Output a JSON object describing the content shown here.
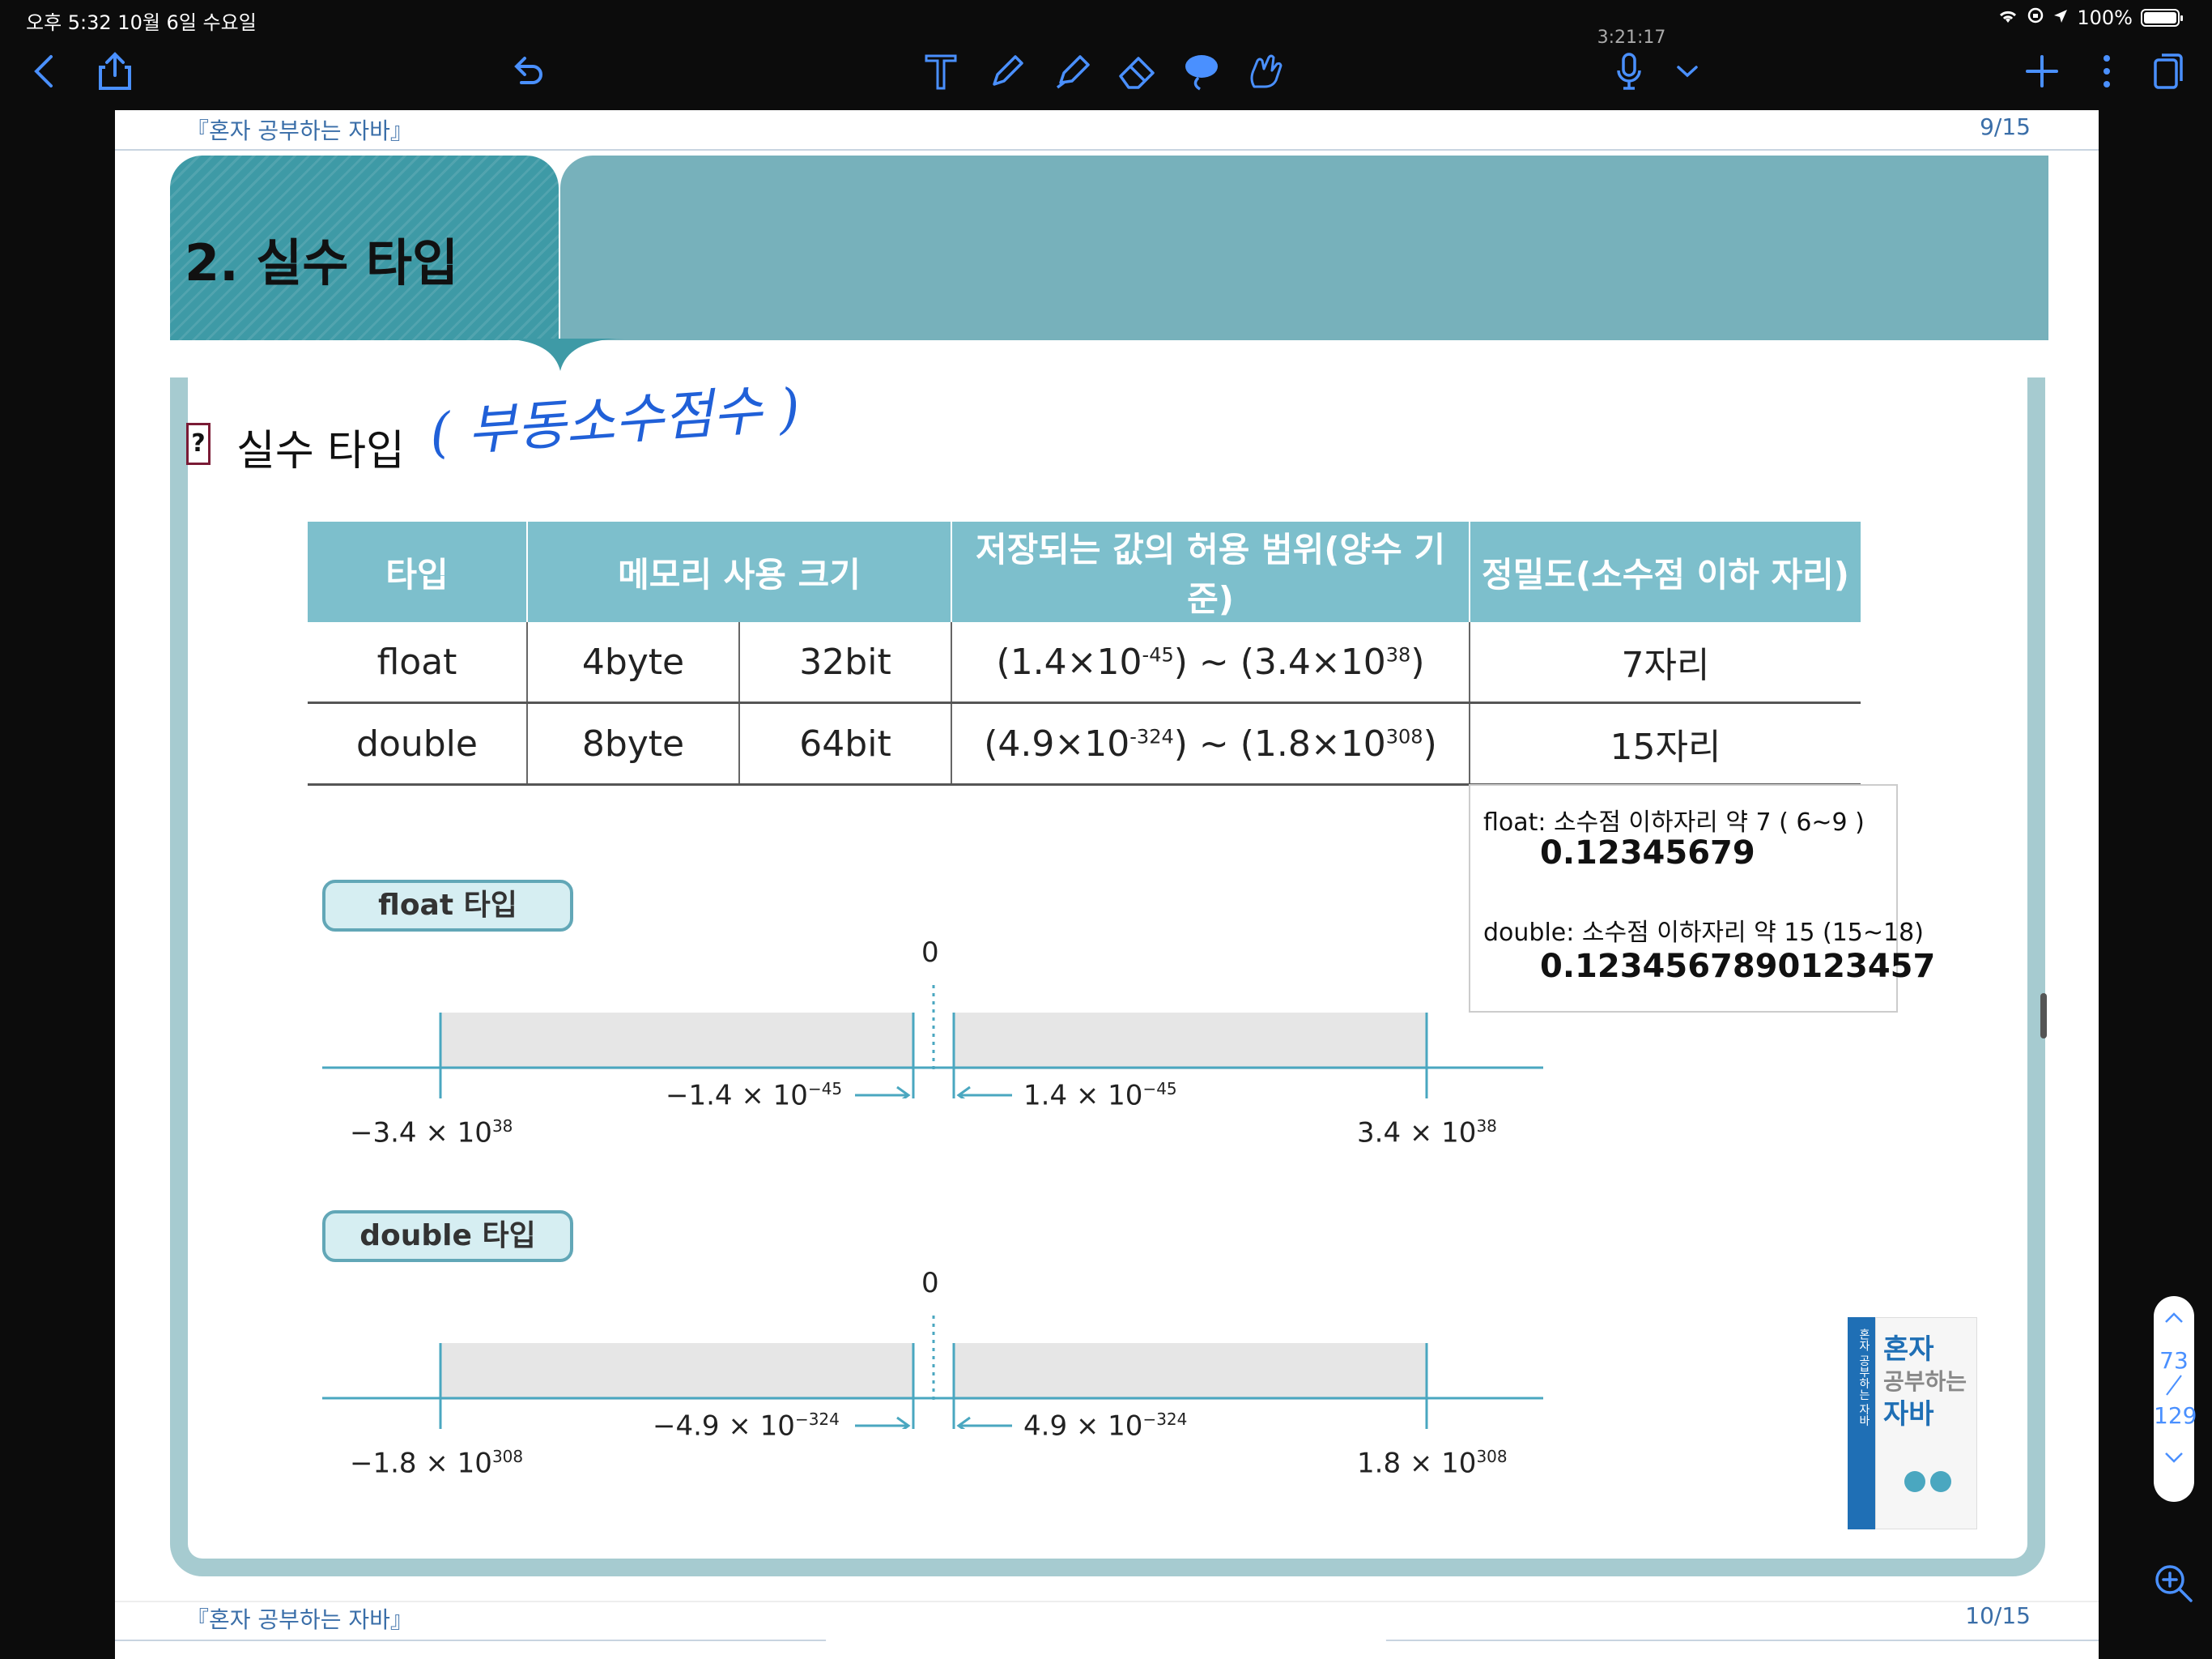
{
  "status_bar": {
    "time_date": "오후 5:32   10월 6일 수요일",
    "battery": "100%"
  },
  "toolbar": {
    "timer": "3:21:17"
  },
  "page": {
    "running_header": "『혼자 공부하는 자바』",
    "page_number": "9/15",
    "next_running_header": "『혼자 공부하는 자바』",
    "next_page_number": "10/15",
    "section_title": "2. 실수 타입",
    "heading": "실수 타입",
    "heading_icon": "?",
    "handwritten_note": "( 부동소수점수 )"
  },
  "table": {
    "headers": [
      "타입",
      "메모리 사용 크기",
      "저장되는 값의 허용 범위(양수 기준)",
      "정밀도(소수점 이하 자리)"
    ],
    "rows": [
      {
        "type": "float",
        "bytes": "4byte",
        "bits": "32bit",
        "range_a": "1.4",
        "exp_a": "-45",
        "range_b": "3.4",
        "exp_b": "38",
        "precision": "7자리"
      },
      {
        "type": "double",
        "bytes": "8byte",
        "bits": "64bit",
        "range_a": "4.9",
        "exp_a": "-324",
        "range_b": "1.8",
        "exp_b": "308",
        "precision": "15자리"
      }
    ],
    "times": "×10",
    "tilde": "~"
  },
  "note_box": {
    "float_label": "float: 소수점 이하자리 약 7 ( 6~9 )",
    "float_value": "0.12345679",
    "double_label": "double: 소수점 이하자리 약 15  (15~18)",
    "double_value": "0.1234567890123457"
  },
  "float_diagram": {
    "label": "float 타입",
    "zero": "0",
    "neg_max": "−3.4 × 10",
    "neg_max_exp": "38",
    "neg_min": "−1.4 × 10",
    "neg_min_exp": "−45",
    "pos_min": "1.4 × 10",
    "pos_min_exp": "−45",
    "pos_max": "3.4 × 10",
    "pos_max_exp": "38"
  },
  "double_diagram": {
    "label": "double 타입",
    "zero": "0",
    "neg_max": "−1.8 × 10",
    "neg_max_exp": "308",
    "neg_min": "−4.9 × 10",
    "neg_min_exp": "−324",
    "pos_min": "4.9 × 10",
    "pos_min_exp": "−324",
    "pos_max": "1.8 × 10",
    "pos_max_exp": "308"
  },
  "book_cover": {
    "title_line1": "혼자",
    "title_line2": "공부하는",
    "title_line3": "자바",
    "spine": "혼자 공부하는 자바"
  },
  "page_scroller": {
    "current": "73",
    "total": "129"
  },
  "colors": {
    "accent": "#4a90ff",
    "banner_dark": "#3e9aa6",
    "banner_light": "#77b1bb",
    "table_header": "#7dbfcc",
    "frame": "#a6cbd0"
  }
}
